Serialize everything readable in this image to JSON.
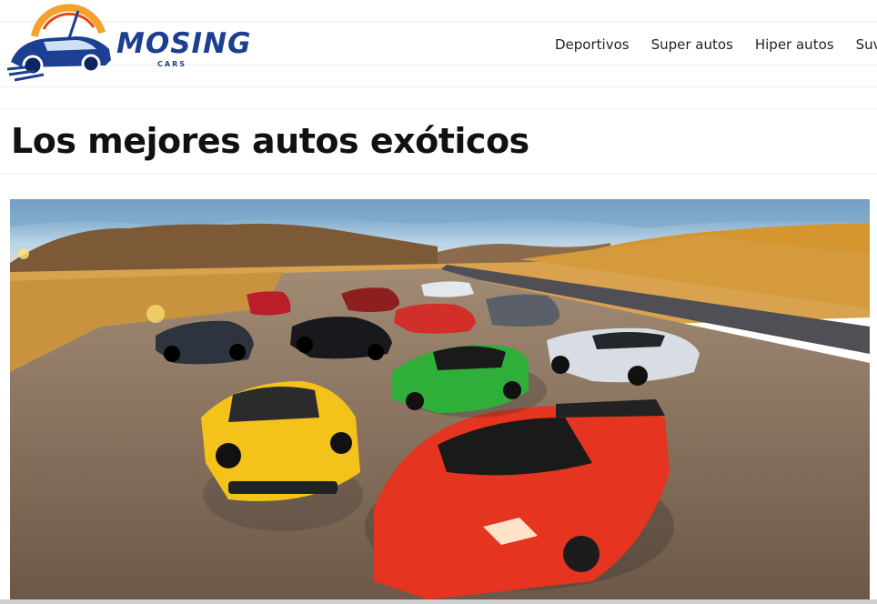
{
  "brand": {
    "name": "MOSING",
    "sub": "CARS",
    "primary_color": "#1d3f91",
    "accent_color": "#f2a12b"
  },
  "nav": {
    "items": [
      {
        "label": "Deportivos"
      },
      {
        "label": "Super autos"
      },
      {
        "label": "Hiper autos"
      },
      {
        "label": "Suvs"
      }
    ]
  },
  "page": {
    "title": "Los mejores autos exóticos"
  },
  "hero": {
    "image": "photo of exotic sports cars parked on a dirt lot among golden hills",
    "cars": [
      "red-car-icon",
      "yellow-car-icon",
      "green-car-icon",
      "white-car-icon",
      "black-car-icon",
      "gray-car-icon"
    ]
  }
}
